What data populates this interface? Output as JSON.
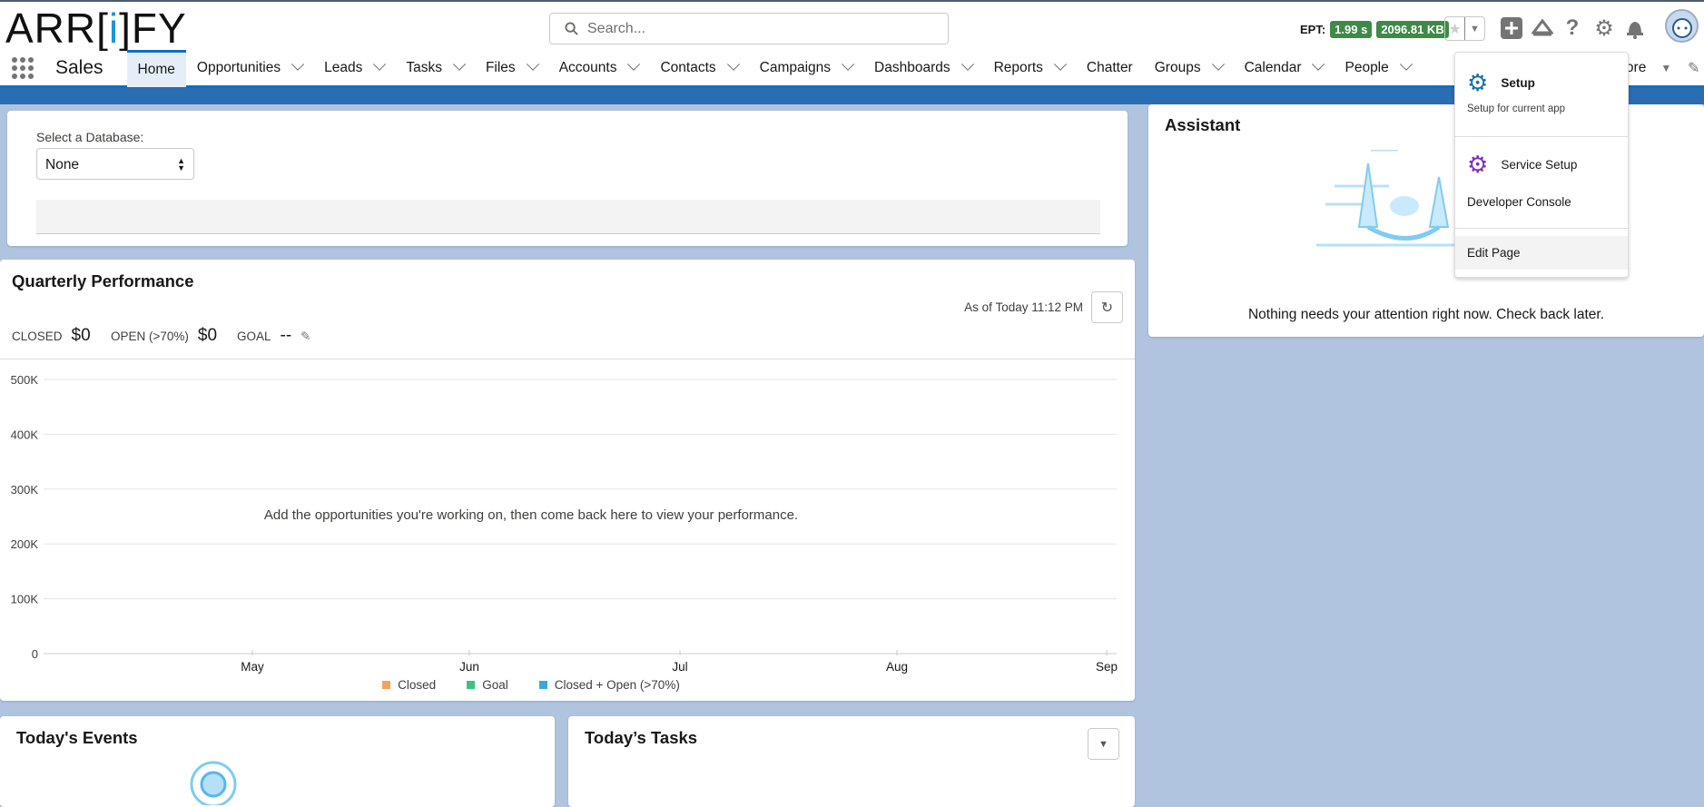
{
  "header": {
    "logo": "ARR[i]FY",
    "logo_parts": [
      "ARR[",
      "i",
      "]FY"
    ],
    "search_placeholder": "Search...",
    "ept_label": "EPT:",
    "ept_time": "1.99 s",
    "ept_size": "2096.81 KB"
  },
  "nav": {
    "app_name": "Sales",
    "items": [
      {
        "label": "Home",
        "active": true,
        "chevron": false
      },
      {
        "label": "Opportunities",
        "chevron": true
      },
      {
        "label": "Leads",
        "chevron": true
      },
      {
        "label": "Tasks",
        "chevron": true
      },
      {
        "label": "Files",
        "chevron": true
      },
      {
        "label": "Accounts",
        "chevron": true
      },
      {
        "label": "Contacts",
        "chevron": true
      },
      {
        "label": "Campaigns",
        "chevron": true
      },
      {
        "label": "Dashboards",
        "chevron": true
      },
      {
        "label": "Reports",
        "chevron": true
      },
      {
        "label": "Chatter",
        "chevron": false
      },
      {
        "label": "Groups",
        "chevron": true
      },
      {
        "label": "Calendar",
        "chevron": true
      },
      {
        "label": "People",
        "chevron": true
      }
    ],
    "more_label": "More"
  },
  "database": {
    "label": "Select a Database:",
    "value": "None"
  },
  "quarterly": {
    "title": "Quarterly Performance",
    "as_of": "As of Today 11:12 PM",
    "closed_label": "CLOSED",
    "closed_value": "$0",
    "open_label": "OPEN (>70%)",
    "open_value": "$0",
    "goal_label": "GOAL",
    "goal_value": "--",
    "empty_message": "Add the opportunities you're working on, then come back here to view your performance."
  },
  "chart_data": {
    "type": "line",
    "x_ticks": [
      "May",
      "Jun",
      "Jul",
      "Aug",
      "Sep"
    ],
    "y_ticks": [
      "0",
      "100K",
      "200K",
      "300K",
      "400K",
      "500K"
    ],
    "ylim": [
      0,
      500000
    ],
    "grid": true,
    "legend_position": "bottom",
    "series": [
      {
        "name": "Closed",
        "color": "#f4a25b",
        "values": []
      },
      {
        "name": "Goal",
        "color": "#3cc47c",
        "values": []
      },
      {
        "name": "Closed + Open (>70%)",
        "color": "#3aa8d8",
        "values": []
      }
    ]
  },
  "assistant": {
    "title": "Assistant",
    "message": "Nothing needs your attention right now. Check back later."
  },
  "setup_menu": {
    "setup": "Setup",
    "setup_sub": "Setup for current app",
    "service_setup": "Service Setup",
    "developer_console": "Developer Console",
    "edit_page": "Edit Page"
  },
  "events": {
    "title": "Today's Events"
  },
  "tasks": {
    "title": "Today’s Tasks"
  },
  "colors": {
    "brand": "#0f6fc1",
    "ept_badge": "#3f8a46",
    "setup_icon": "#1b6fa8",
    "service_icon": "#7b2fbf"
  }
}
